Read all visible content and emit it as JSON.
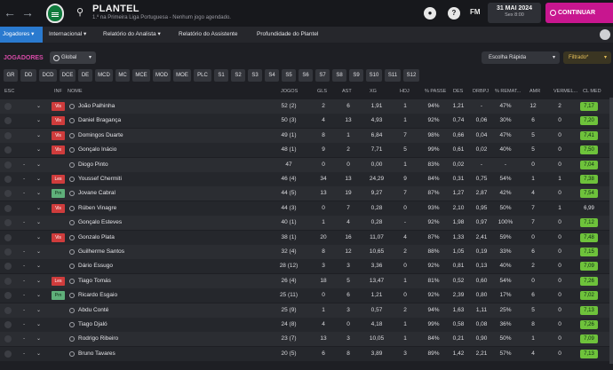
{
  "header": {
    "title": "PLANTEL",
    "subtitle": "1.º na Primeira Liga Portuguesa - Nenhum jogo agendado.",
    "fm_label": "FM",
    "date_main": "31 MAI 2024",
    "date_sub": "Sex 8:00",
    "continue_label": "CONTINUAR",
    "help_label": "?"
  },
  "menu": {
    "items": [
      "Jogadores",
      "Internacional",
      "Relatório do Analista",
      "Relatório do Assistente",
      "Profundidade do Plantel"
    ]
  },
  "panel": {
    "section_label": "JOGADORES",
    "scope": "Global",
    "quick_pick": "Escolha Rápida",
    "filter": "Filtrado*"
  },
  "view_tabs": [
    "GR",
    "DD",
    "DCD",
    "DCE",
    "DE",
    "MCD",
    "MC",
    "MCE",
    "MOD",
    "MOE",
    "PLC",
    "S1",
    "S2",
    "S3",
    "S4",
    "S5",
    "S6",
    "S7",
    "S8",
    "S9",
    "S10",
    "S11",
    "S12"
  ],
  "table": {
    "columns": [
      "ESC",
      "INF",
      "NOME",
      "JOGOS",
      "GLS",
      "AST",
      "XG",
      "HDJ",
      "% PASSE",
      "DES",
      "DRBPJ",
      "% REMAT...",
      "AMR",
      "VERMEL...",
      "CL MED"
    ],
    "rows": [
      {
        "badge": "Vis",
        "badge_color": "red",
        "dash": "",
        "name": "João Palhinha",
        "jogos": "52 (2)",
        "gls": "2",
        "ast": "6",
        "xg": "1,91",
        "hdj": "1",
        "passe": "94%",
        "des": "1,21",
        "drbpj": "-",
        "remat": "47%",
        "amr": "12",
        "verm": "2",
        "rating": "7,17",
        "rating_good": true
      },
      {
        "badge": "Vis",
        "badge_color": "red",
        "dash": "",
        "name": "Daniel Bragança",
        "jogos": "50 (3)",
        "gls": "4",
        "ast": "13",
        "xg": "4,93",
        "hdj": "1",
        "passe": "92%",
        "des": "0,74",
        "drbpj": "0,06",
        "remat": "30%",
        "amr": "6",
        "verm": "0",
        "rating": "7,20",
        "rating_good": true
      },
      {
        "badge": "Vis",
        "badge_color": "red",
        "dash": "",
        "name": "Domingos Duarte",
        "jogos": "49 (1)",
        "gls": "8",
        "ast": "1",
        "xg": "6,84",
        "hdj": "7",
        "passe": "98%",
        "des": "0,66",
        "drbpj": "0,04",
        "remat": "47%",
        "amr": "5",
        "verm": "0",
        "rating": "7,41",
        "rating_good": true
      },
      {
        "badge": "Vis",
        "badge_color": "red",
        "dash": "",
        "name": "Gonçalo Inácio",
        "jogos": "48 (1)",
        "gls": "9",
        "ast": "2",
        "xg": "7,71",
        "hdj": "5",
        "passe": "99%",
        "des": "0,61",
        "drbpj": "0,02",
        "remat": "40%",
        "amr": "5",
        "verm": "0",
        "rating": "7,50",
        "rating_good": true
      },
      {
        "badge": "",
        "badge_color": "",
        "dash": "-",
        "name": "Diogo Pinto",
        "jogos": "47",
        "gls": "0",
        "ast": "0",
        "xg": "0,00",
        "hdj": "1",
        "passe": "83%",
        "des": "0,02",
        "drbpj": "-",
        "remat": "-",
        "amr": "0",
        "verm": "0",
        "rating": "7,04",
        "rating_good": true
      },
      {
        "badge": "Les",
        "badge_color": "red",
        "dash": "-",
        "name": "Youssef Chermiti",
        "jogos": "46 (4)",
        "gls": "34",
        "ast": "13",
        "xg": "24,29",
        "hdj": "9",
        "passe": "84%",
        "des": "0,31",
        "drbpj": "0,75",
        "remat": "54%",
        "amr": "1",
        "verm": "1",
        "rating": "7,38",
        "rating_good": true
      },
      {
        "badge": "Prn",
        "badge_color": "green",
        "dash": "-",
        "name": "Jovane Cabral",
        "jogos": "44 (5)",
        "gls": "13",
        "ast": "19",
        "xg": "9,27",
        "hdj": "7",
        "passe": "87%",
        "des": "1,27",
        "drbpj": "2,87",
        "remat": "42%",
        "amr": "4",
        "verm": "0",
        "rating": "7,54",
        "rating_good": true
      },
      {
        "badge": "Vis",
        "badge_color": "red",
        "dash": "",
        "name": "Rúben Vinagre",
        "jogos": "44 (3)",
        "gls": "0",
        "ast": "7",
        "xg": "0,28",
        "hdj": "0",
        "passe": "93%",
        "des": "2,10",
        "drbpj": "0,95",
        "remat": "50%",
        "amr": "7",
        "verm": "1",
        "rating": "6,99",
        "rating_good": false
      },
      {
        "badge": "",
        "badge_color": "",
        "dash": "-",
        "name": "Gonçalo Esteves",
        "jogos": "40 (1)",
        "gls": "1",
        "ast": "4",
        "xg": "0,28",
        "hdj": "-",
        "passe": "92%",
        "des": "1,98",
        "drbpj": "0,97",
        "remat": "100%",
        "amr": "7",
        "verm": "0",
        "rating": "7,12",
        "rating_good": true
      },
      {
        "badge": "Vis",
        "badge_color": "red",
        "dash": "",
        "name": "Gonzalo Plata",
        "jogos": "38 (1)",
        "gls": "20",
        "ast": "16",
        "xg": "11,07",
        "hdj": "4",
        "passe": "87%",
        "des": "1,33",
        "drbpj": "2,41",
        "remat": "59%",
        "amr": "0",
        "verm": "0",
        "rating": "7,48",
        "rating_good": true
      },
      {
        "badge": "",
        "badge_color": "",
        "dash": "-",
        "name": "Guilherme Santos",
        "jogos": "32 (4)",
        "gls": "8",
        "ast": "12",
        "xg": "10,65",
        "hdj": "2",
        "passe": "88%",
        "des": "1,05",
        "drbpj": "0,19",
        "remat": "33%",
        "amr": "6",
        "verm": "0",
        "rating": "7,15",
        "rating_good": true
      },
      {
        "badge": "",
        "badge_color": "",
        "dash": "-",
        "name": "Dário Essugo",
        "jogos": "28 (12)",
        "gls": "3",
        "ast": "3",
        "xg": "3,36",
        "hdj": "0",
        "passe": "92%",
        "des": "0,81",
        "drbpj": "0,13",
        "remat": "40%",
        "amr": "2",
        "verm": "0",
        "rating": "7,09",
        "rating_good": true
      },
      {
        "badge": "Les",
        "badge_color": "red",
        "dash": "-",
        "name": "Tiago Tomás",
        "jogos": "26 (4)",
        "gls": "18",
        "ast": "5",
        "xg": "13,47",
        "hdj": "1",
        "passe": "81%",
        "des": "0,52",
        "drbpj": "0,60",
        "remat": "54%",
        "amr": "0",
        "verm": "0",
        "rating": "7,26",
        "rating_good": true
      },
      {
        "badge": "Prn",
        "badge_color": "green",
        "dash": "-",
        "name": "Ricardo Esgaio",
        "jogos": "25 (11)",
        "gls": "0",
        "ast": "6",
        "xg": "1,21",
        "hdj": "0",
        "passe": "92%",
        "des": "2,39",
        "drbpj": "0,80",
        "remat": "17%",
        "amr": "6",
        "verm": "0",
        "rating": "7,02",
        "rating_good": true
      },
      {
        "badge": "",
        "badge_color": "",
        "dash": "-",
        "name": "Abdu Conté",
        "jogos": "25 (9)",
        "gls": "1",
        "ast": "3",
        "xg": "0,57",
        "hdj": "2",
        "passe": "94%",
        "des": "1,63",
        "drbpj": "1,11",
        "remat": "25%",
        "amr": "5",
        "verm": "0",
        "rating": "7,13",
        "rating_good": true
      },
      {
        "badge": "",
        "badge_color": "",
        "dash": "-",
        "name": "Tiago Djaló",
        "jogos": "24 (8)",
        "gls": "4",
        "ast": "0",
        "xg": "4,18",
        "hdj": "1",
        "passe": "99%",
        "des": "0,58",
        "drbpj": "0,08",
        "remat": "36%",
        "amr": "8",
        "verm": "0",
        "rating": "7,26",
        "rating_good": true
      },
      {
        "badge": "",
        "badge_color": "",
        "dash": "-",
        "name": "Rodrigo Ribeiro",
        "jogos": "23 (7)",
        "gls": "13",
        "ast": "3",
        "xg": "10,05",
        "hdj": "1",
        "passe": "84%",
        "des": "0,21",
        "drbpj": "0,90",
        "remat": "50%",
        "amr": "1",
        "verm": "0",
        "rating": "7,09",
        "rating_good": true
      },
      {
        "badge": "",
        "badge_color": "",
        "dash": "-",
        "name": "Bruno Tavares",
        "jogos": "20 (5)",
        "gls": "6",
        "ast": "8",
        "xg": "3,89",
        "hdj": "3",
        "passe": "89%",
        "des": "1,42",
        "drbpj": "2,21",
        "remat": "57%",
        "amr": "4",
        "verm": "0",
        "rating": "7,13",
        "rating_good": true
      }
    ]
  },
  "icons": [
    "back-arrow-icon",
    "forward-arrow-icon",
    "club-crest-icon",
    "search-icon",
    "football-icon",
    "help-icon",
    "globe-icon",
    "settings-icon"
  ],
  "colors": {
    "accent": "#c8168f",
    "tab_active": "#2a7acf",
    "rating_good": "#6ec23b",
    "badge_red": "#cf3c3c",
    "filter": "#e6c05a"
  }
}
